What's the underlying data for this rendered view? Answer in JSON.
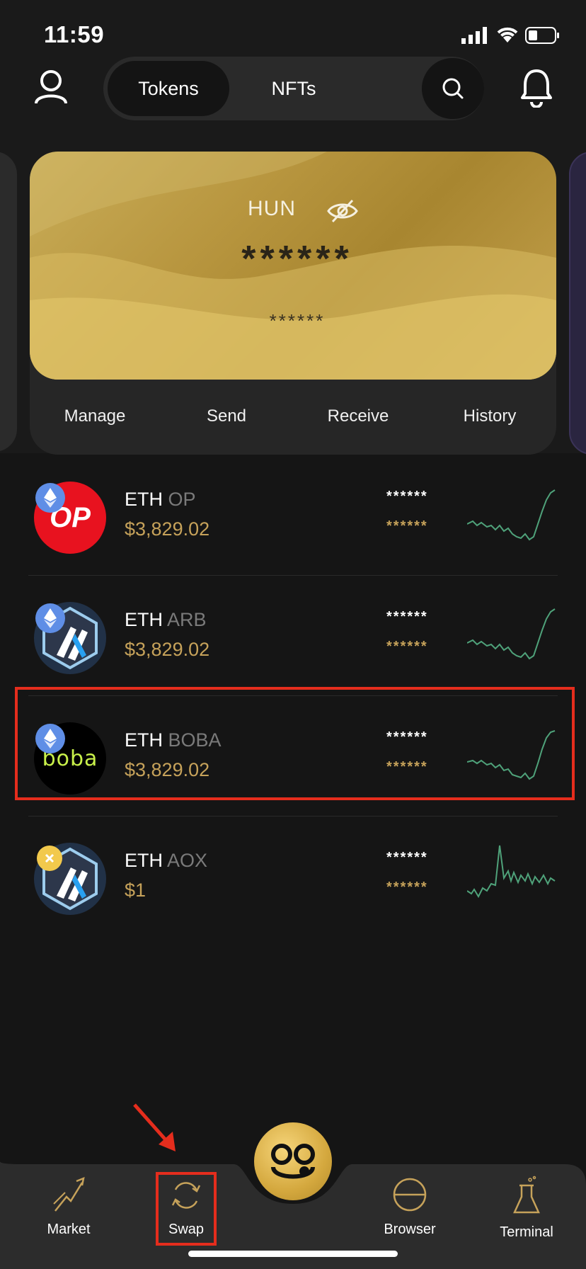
{
  "status_bar": {
    "time": "11:59"
  },
  "header": {
    "tabs": [
      {
        "label": "Tokens",
        "active": true
      },
      {
        "label": "NFTs",
        "active": false
      }
    ],
    "icons": [
      "profile-icon",
      "search-icon",
      "bell-icon"
    ]
  },
  "card": {
    "name": "HUN",
    "balance": "******",
    "sub_balance": "******",
    "actions": [
      "Manage",
      "Send",
      "Receive",
      "History"
    ]
  },
  "tokens": [
    {
      "symbol": "ETH",
      "chain": "OP",
      "price": "$3,829.02",
      "balance": "******",
      "value": "******",
      "badge": "eth"
    },
    {
      "symbol": "ETH",
      "chain": "ARB",
      "price": "$3,829.02",
      "balance": "******",
      "value": "******",
      "badge": "eth"
    },
    {
      "symbol": "ETH",
      "chain": "BOBA",
      "price": "$3,829.02",
      "balance": "******",
      "value": "******",
      "badge": "eth"
    },
    {
      "symbol": "ETH",
      "chain": "AOX",
      "price": "$1",
      "balance": "******",
      "value": "******",
      "badge": "x"
    }
  ],
  "boba_logo_text": "boba",
  "op_logo_text": "OP",
  "bottom_nav": [
    {
      "label": "Market",
      "icon": "market-icon"
    },
    {
      "label": "Swap",
      "icon": "swap-icon"
    },
    {
      "label": "Browser",
      "icon": "browser-icon"
    },
    {
      "label": "Terminal",
      "icon": "terminal-icon"
    }
  ],
  "colors": {
    "gold": "#c6a25a",
    "highlight": "#e52d1d",
    "sparkline": "#4fa27a"
  }
}
